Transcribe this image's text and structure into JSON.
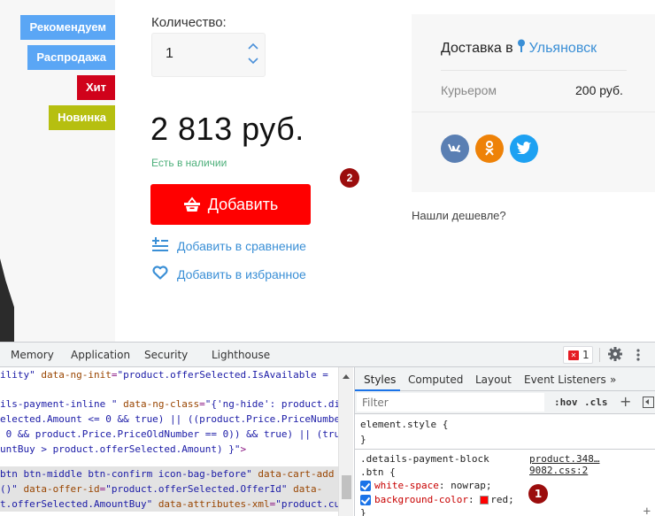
{
  "product": {
    "badges": [
      {
        "label": "Рекомендуем",
        "color": "#5aa6f5"
      },
      {
        "label": "Распродажа",
        "color": "#5aa6f5"
      },
      {
        "label": "Хит",
        "color": "#d0021b"
      },
      {
        "label": "Новинка",
        "color": "#b6bf10"
      }
    ],
    "quantity_label": "Количество:",
    "quantity_value": "1",
    "price": "2 813 руб.",
    "stock_status": "Есть в наличии",
    "add_button_label": "Добавить",
    "add_button_color": "#ff0000",
    "compare_label": "Добавить в сравнение",
    "favorite_label": "Добавить в избранное"
  },
  "delivery": {
    "title": "Доставка в",
    "city": "Ульяновск",
    "courier_label": "Курьером",
    "courier_price": "200 руб.",
    "socials": [
      {
        "name": "vk",
        "glyph": "vk"
      },
      {
        "name": "ok",
        "glyph": "ok"
      },
      {
        "name": "twitter",
        "glyph": "tw"
      }
    ],
    "cheaper_link": "Нашли дешевле?"
  },
  "markers": {
    "m1": "1",
    "m2": "2"
  },
  "devtools": {
    "tabs": [
      "Memory",
      "Application",
      "Security",
      "Lighthouse"
    ],
    "error_count": "1",
    "elements_lines": [
      {
        "parts": [
          [
            "val",
            "ility\""
          ],
          [
            "plain",
            " "
          ],
          [
            "attr",
            "data-ng-init"
          ],
          [
            "punc",
            "="
          ],
          [
            "val",
            "\"product.offerSelected.IsAvailable ="
          ]
        ]
      },
      {
        "parts": [
          [
            "plain",
            ""
          ]
        ]
      },
      {
        "parts": [
          [
            "val",
            "ils-payment-inline \""
          ],
          [
            "plain",
            " "
          ],
          [
            "attr",
            "data-ng-class"
          ],
          [
            "punc",
            "="
          ],
          [
            "val",
            "\"{'ng-hide': product.di"
          ]
        ]
      },
      {
        "parts": [
          [
            "val",
            "elected.Amount <= 0 && true) || ((product.Price.PriceNumbe"
          ]
        ]
      },
      {
        "parts": [
          [
            "val",
            " 0 && product.Price.PriceOldNumber == 0)) && true) || (tru"
          ]
        ]
      },
      {
        "parts": [
          [
            "val",
            "untBuy > product.offerSelected.Amount) }\""
          ],
          [
            "punc",
            ">"
          ]
        ]
      },
      {
        "parts": [
          [
            "val",
            "btn btn-middle btn-confirm icon-bag-before\""
          ],
          [
            "plain",
            " "
          ],
          [
            "attr",
            "data-cart-add"
          ]
        ]
      },
      {
        "parts": [
          [
            "val",
            "()\""
          ],
          [
            "plain",
            " "
          ],
          [
            "attr",
            "data-offer-id"
          ],
          [
            "punc",
            "="
          ],
          [
            "val",
            "\"product.offerSelected.OfferId\""
          ],
          [
            "plain",
            " "
          ],
          [
            "attr",
            "data-"
          ]
        ]
      },
      {
        "parts": [
          [
            "val",
            "t.offerSelected.AmountBuy\""
          ],
          [
            "plain",
            " "
          ],
          [
            "attr",
            "data-attributes-xml"
          ],
          [
            "punc",
            "="
          ],
          [
            "val",
            "\"product.cu"
          ]
        ]
      }
    ],
    "styles_tabs": [
      "Styles",
      "Computed",
      "Layout",
      "Event Listeners",
      "»"
    ],
    "filter_placeholder": "Filter",
    "hov_label": ":hov",
    "cls_label": ".cls",
    "element_style_open": "element.style {",
    "close_brace": "}",
    "rule_selector_1": ".details-payment-block",
    "rule_selector_2": ".btn {",
    "rule_source": "product.348…9082.css:2",
    "properties": [
      {
        "name": "white-space",
        "value": "nowrap;",
        "checked": true
      },
      {
        "name": "background-color",
        "value": "red;",
        "checked": true,
        "swatch": "#ff0000"
      }
    ]
  }
}
